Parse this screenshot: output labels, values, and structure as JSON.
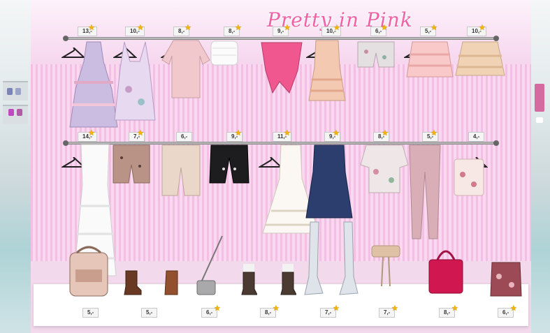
{
  "logo": {
    "text": "Pretty in Pink"
  },
  "top_rack": {
    "prices": [
      "13,-",
      "10,-",
      "8,-",
      "8,-",
      "9,-",
      "10,-",
      "6,-",
      "5,-",
      "10,-"
    ]
  },
  "middle_rack": {
    "prices": [
      "14,-",
      "7,-",
      "6,-",
      "9,-",
      "11,-",
      "9,-",
      "8,-",
      "5,-",
      "4,-"
    ]
  },
  "counter": {
    "prices": [
      "5,-",
      "5,-",
      "6,-",
      "8,-",
      "7,-",
      "7,-",
      "8,-",
      "6,-"
    ]
  },
  "colors": {
    "accent": "#ef62a6",
    "stripe_light": "#fad8f0",
    "stripe_dark": "#f3bfe4"
  }
}
